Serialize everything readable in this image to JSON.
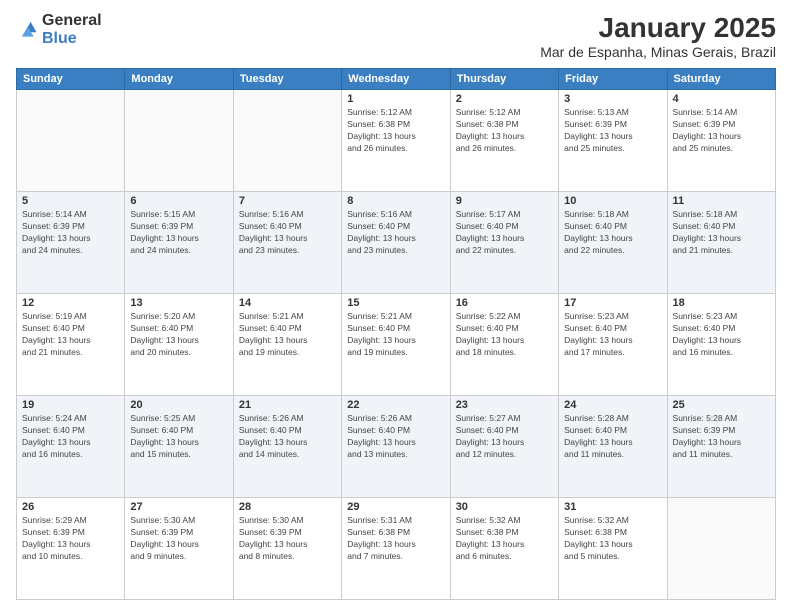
{
  "logo": {
    "general": "General",
    "blue": "Blue"
  },
  "header": {
    "month": "January 2025",
    "location": "Mar de Espanha, Minas Gerais, Brazil"
  },
  "weekdays": [
    "Sunday",
    "Monday",
    "Tuesday",
    "Wednesday",
    "Thursday",
    "Friday",
    "Saturday"
  ],
  "weeks": [
    [
      {
        "day": "",
        "info": ""
      },
      {
        "day": "",
        "info": ""
      },
      {
        "day": "",
        "info": ""
      },
      {
        "day": "1",
        "info": "Sunrise: 5:12 AM\nSunset: 6:38 PM\nDaylight: 13 hours\nand 26 minutes."
      },
      {
        "day": "2",
        "info": "Sunrise: 5:12 AM\nSunset: 6:38 PM\nDaylight: 13 hours\nand 26 minutes."
      },
      {
        "day": "3",
        "info": "Sunrise: 5:13 AM\nSunset: 6:39 PM\nDaylight: 13 hours\nand 25 minutes."
      },
      {
        "day": "4",
        "info": "Sunrise: 5:14 AM\nSunset: 6:39 PM\nDaylight: 13 hours\nand 25 minutes."
      }
    ],
    [
      {
        "day": "5",
        "info": "Sunrise: 5:14 AM\nSunset: 6:39 PM\nDaylight: 13 hours\nand 24 minutes."
      },
      {
        "day": "6",
        "info": "Sunrise: 5:15 AM\nSunset: 6:39 PM\nDaylight: 13 hours\nand 24 minutes."
      },
      {
        "day": "7",
        "info": "Sunrise: 5:16 AM\nSunset: 6:40 PM\nDaylight: 13 hours\nand 23 minutes."
      },
      {
        "day": "8",
        "info": "Sunrise: 5:16 AM\nSunset: 6:40 PM\nDaylight: 13 hours\nand 23 minutes."
      },
      {
        "day": "9",
        "info": "Sunrise: 5:17 AM\nSunset: 6:40 PM\nDaylight: 13 hours\nand 22 minutes."
      },
      {
        "day": "10",
        "info": "Sunrise: 5:18 AM\nSunset: 6:40 PM\nDaylight: 13 hours\nand 22 minutes."
      },
      {
        "day": "11",
        "info": "Sunrise: 5:18 AM\nSunset: 6:40 PM\nDaylight: 13 hours\nand 21 minutes."
      }
    ],
    [
      {
        "day": "12",
        "info": "Sunrise: 5:19 AM\nSunset: 6:40 PM\nDaylight: 13 hours\nand 21 minutes."
      },
      {
        "day": "13",
        "info": "Sunrise: 5:20 AM\nSunset: 6:40 PM\nDaylight: 13 hours\nand 20 minutes."
      },
      {
        "day": "14",
        "info": "Sunrise: 5:21 AM\nSunset: 6:40 PM\nDaylight: 13 hours\nand 19 minutes."
      },
      {
        "day": "15",
        "info": "Sunrise: 5:21 AM\nSunset: 6:40 PM\nDaylight: 13 hours\nand 19 minutes."
      },
      {
        "day": "16",
        "info": "Sunrise: 5:22 AM\nSunset: 6:40 PM\nDaylight: 13 hours\nand 18 minutes."
      },
      {
        "day": "17",
        "info": "Sunrise: 5:23 AM\nSunset: 6:40 PM\nDaylight: 13 hours\nand 17 minutes."
      },
      {
        "day": "18",
        "info": "Sunrise: 5:23 AM\nSunset: 6:40 PM\nDaylight: 13 hours\nand 16 minutes."
      }
    ],
    [
      {
        "day": "19",
        "info": "Sunrise: 5:24 AM\nSunset: 6:40 PM\nDaylight: 13 hours\nand 16 minutes."
      },
      {
        "day": "20",
        "info": "Sunrise: 5:25 AM\nSunset: 6:40 PM\nDaylight: 13 hours\nand 15 minutes."
      },
      {
        "day": "21",
        "info": "Sunrise: 5:26 AM\nSunset: 6:40 PM\nDaylight: 13 hours\nand 14 minutes."
      },
      {
        "day": "22",
        "info": "Sunrise: 5:26 AM\nSunset: 6:40 PM\nDaylight: 13 hours\nand 13 minutes."
      },
      {
        "day": "23",
        "info": "Sunrise: 5:27 AM\nSunset: 6:40 PM\nDaylight: 13 hours\nand 12 minutes."
      },
      {
        "day": "24",
        "info": "Sunrise: 5:28 AM\nSunset: 6:40 PM\nDaylight: 13 hours\nand 11 minutes."
      },
      {
        "day": "25",
        "info": "Sunrise: 5:28 AM\nSunset: 6:39 PM\nDaylight: 13 hours\nand 11 minutes."
      }
    ],
    [
      {
        "day": "26",
        "info": "Sunrise: 5:29 AM\nSunset: 6:39 PM\nDaylight: 13 hours\nand 10 minutes."
      },
      {
        "day": "27",
        "info": "Sunrise: 5:30 AM\nSunset: 6:39 PM\nDaylight: 13 hours\nand 9 minutes."
      },
      {
        "day": "28",
        "info": "Sunrise: 5:30 AM\nSunset: 6:39 PM\nDaylight: 13 hours\nand 8 minutes."
      },
      {
        "day": "29",
        "info": "Sunrise: 5:31 AM\nSunset: 6:38 PM\nDaylight: 13 hours\nand 7 minutes."
      },
      {
        "day": "30",
        "info": "Sunrise: 5:32 AM\nSunset: 6:38 PM\nDaylight: 13 hours\nand 6 minutes."
      },
      {
        "day": "31",
        "info": "Sunrise: 5:32 AM\nSunset: 6:38 PM\nDaylight: 13 hours\nand 5 minutes."
      },
      {
        "day": "",
        "info": ""
      }
    ]
  ]
}
